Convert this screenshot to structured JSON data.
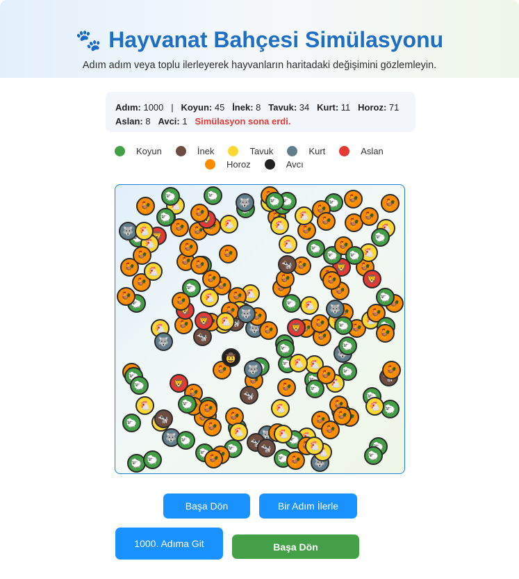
{
  "header": {
    "paw_icon": "🐾",
    "title": "Hayvanat Bahçesi Simülasyonu",
    "subtitle": "Adım adım veya toplu ilerleyerek hayvanların haritadaki değişimini gözlemleyin."
  },
  "stats": {
    "step_label": "Adım:",
    "step": "1000",
    "separator": "|",
    "koyun_label": "Koyun:",
    "koyun": "45",
    "inek_label": "İnek:",
    "inek": "8",
    "tavuk_label": "Tavuk:",
    "tavuk": "34",
    "kurt_label": "Kurt:",
    "kurt": "11",
    "horoz_label": "Horoz:",
    "horoz": "71",
    "aslan_label": "Aslan:",
    "aslan": "8",
    "avci_label": "Avci:",
    "avci": "1",
    "status": "Simülasyon sona erdi."
  },
  "legend": [
    {
      "label": "Koyun",
      "color": "#43a047"
    },
    {
      "label": "İnek",
      "color": "#6d4c41"
    },
    {
      "label": "Tavuk",
      "color": "#fdd835"
    },
    {
      "label": "Kurt",
      "color": "#607d8b"
    },
    {
      "label": "Aslan",
      "color": "#e53935"
    },
    {
      "label": "Horoz",
      "color": "#fb8c00"
    },
    {
      "label": "Avcı",
      "color": "#212121"
    }
  ],
  "species": {
    "koyun": {
      "color": "#43a047",
      "icon": "🐑"
    },
    "inek": {
      "color": "#6d4c41",
      "icon": "🐄"
    },
    "tavuk": {
      "color": "#fdd835",
      "icon": "🐔"
    },
    "kurt": {
      "color": "#607d8b",
      "icon": "🐺"
    },
    "aslan": {
      "color": "#e53935",
      "icon": "🦁"
    },
    "horoz": {
      "color": "#fb8c00",
      "icon": "🐓"
    },
    "avci": {
      "color": "#212121",
      "icon": "🤠"
    }
  },
  "buttons": {
    "reset_top": "Başa Dön",
    "step_forward": "Bir Adım İlerle",
    "goto_1000": "1000. Adıma Git",
    "reset_bottom": "Başa Dön"
  }
}
